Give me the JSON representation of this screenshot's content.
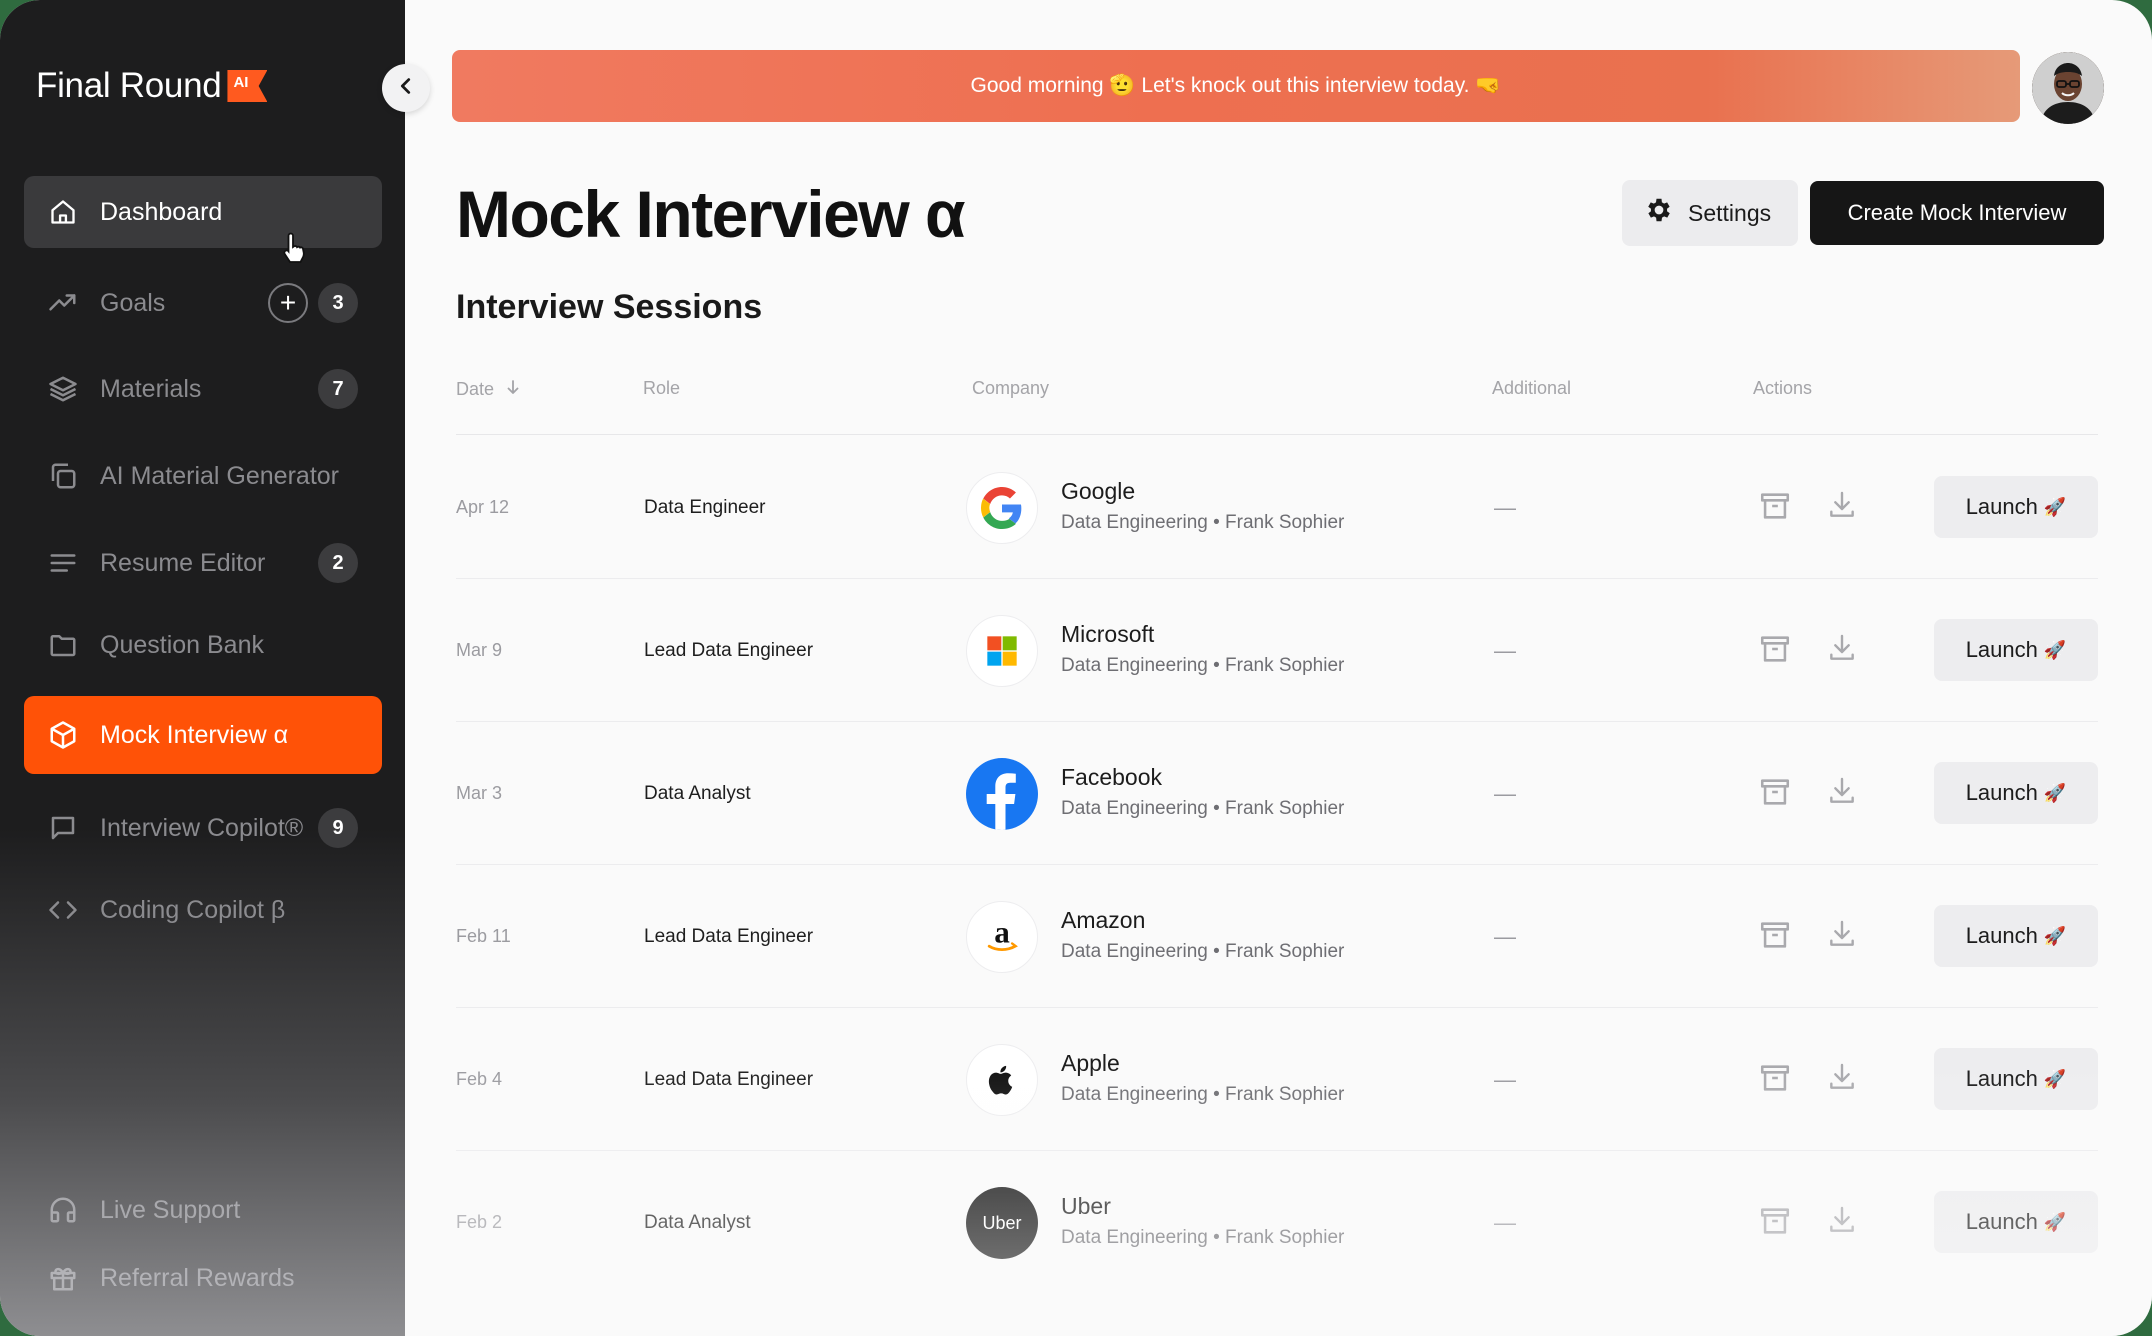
{
  "brand": {
    "name": "Final Round",
    "tag": "AI"
  },
  "sidebar": {
    "items": [
      {
        "label": "Dashboard",
        "icon": "home-icon"
      },
      {
        "label": "Goals",
        "icon": "trending-up-icon",
        "badge": "3"
      },
      {
        "label": "Materials",
        "icon": "layers-icon",
        "badge": "7"
      },
      {
        "label": "AI Material Generator",
        "icon": "copy-icon"
      },
      {
        "label": "Resume Editor",
        "icon": "align-left-icon",
        "badge": "2"
      },
      {
        "label": "Question Bank",
        "icon": "folder-icon"
      },
      {
        "label": "Mock Interview α",
        "icon": "box-icon"
      },
      {
        "label": "Interview Copilot®",
        "icon": "message-square-icon",
        "badge": "9"
      },
      {
        "label": "Coding Copilot β",
        "icon": "code-icon"
      }
    ],
    "footer": [
      {
        "label": "Live Support",
        "icon": "headphones-icon"
      },
      {
        "label": "Referral Rewards",
        "icon": "gift-icon"
      }
    ]
  },
  "banner": {
    "text": "Good morning 🫡 Let's knock out this interview today. 🤜"
  },
  "page": {
    "title": "Mock Interview α",
    "settings_label": "Settings",
    "create_label": "Create Mock Interview",
    "section_title": "Interview Sessions"
  },
  "table": {
    "headers": {
      "date": "Date",
      "role": "Role",
      "company": "Company",
      "additional": "Additional",
      "actions": "Actions"
    },
    "rows": [
      {
        "date": "Apr 12",
        "role": "Data Engineer",
        "company": "Google",
        "sub": "Data Engineering • Frank Sophier",
        "additional": "—",
        "launch": "Launch",
        "logo": "google-logo"
      },
      {
        "date": "Mar 9",
        "role": "Lead Data Engineer",
        "company": "Microsoft",
        "sub": "Data Engineering • Frank Sophier",
        "additional": "—",
        "launch": "Launch",
        "logo": "microsoft-logo"
      },
      {
        "date": "Mar 3",
        "role": "Data Analyst",
        "company": "Facebook",
        "sub": "Data Engineering • Frank Sophier",
        "additional": "—",
        "launch": "Launch",
        "logo": "facebook-logo"
      },
      {
        "date": "Feb 11",
        "role": "Lead Data Engineer",
        "company": "Amazon",
        "sub": "Data Engineering • Frank Sophier",
        "additional": "—",
        "launch": "Launch",
        "logo": "amazon-logo"
      },
      {
        "date": "Feb 4",
        "role": "Lead Data Engineer",
        "company": "Apple",
        "sub": "Data Engineering • Frank Sophier",
        "additional": "—",
        "launch": "Launch",
        "logo": "apple-logo"
      },
      {
        "date": "Feb 2",
        "role": "Data Analyst",
        "company": "Uber",
        "sub": "Data Engineering • Frank Sophier",
        "additional": "—",
        "launch": "Launch",
        "logo": "uber-logo",
        "logo_text": "Uber"
      }
    ]
  },
  "colors": {
    "accent": "#ff5207",
    "sidebar_bg": "#1d1d1e",
    "banner": "#ee6f50"
  }
}
